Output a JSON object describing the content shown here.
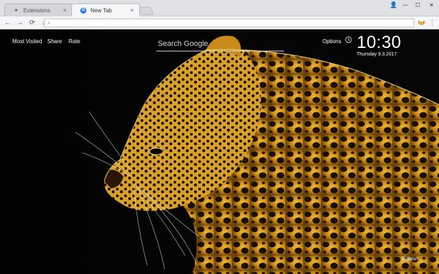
{
  "browser": {
    "tabs": [
      {
        "title": "Extensions",
        "favicon": "puzzle-icon",
        "active": false
      },
      {
        "title": "New Tab",
        "favicon": "globe-icon",
        "active": true
      }
    ],
    "close_glyph": "×",
    "window_controls": {
      "user": "👤",
      "minimize": "—",
      "maximize": "☐",
      "close": "✕"
    },
    "toolbar": {
      "back": "←",
      "forward": "→",
      "reload": "⟳",
      "home": "⌂",
      "menu": "⋮"
    },
    "omnibox": {
      "value": "",
      "placeholder": ""
    }
  },
  "newtab": {
    "links": {
      "most_visited": "Most Visited",
      "share": "Share",
      "rate": "Rate"
    },
    "search": {
      "placeholder": "Search Google"
    },
    "options_label": "Options",
    "time": "10:30",
    "date": "Thursday  9.3.2017",
    "support_label": "Support"
  },
  "colors": {
    "wallpaper_dark": "#000000",
    "fur": "#e3a21c",
    "fur_light": "#f4d15a"
  }
}
